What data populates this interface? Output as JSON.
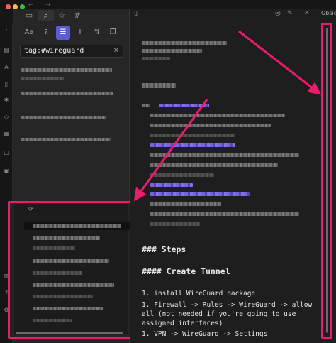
{
  "window": {
    "title": "Obsidian",
    "nav_back": "←",
    "nav_forward": "→"
  },
  "ribbon": {
    "icons": [
      "files-icon",
      "search-icon",
      "graph-icon",
      "calendar-icon",
      "templates-icon",
      "settings-icon"
    ]
  },
  "sidebar": {
    "tabs": [
      {
        "name": "folder-icon",
        "glyph": "▭"
      },
      {
        "name": "search-icon",
        "glyph": "⌕"
      },
      {
        "name": "star-icon",
        "glyph": "☆"
      },
      {
        "name": "hash-icon",
        "glyph": "#"
      }
    ],
    "tools": [
      {
        "name": "text-size-icon",
        "glyph": "Aa"
      },
      {
        "name": "help-icon",
        "glyph": "?"
      },
      {
        "name": "list-icon",
        "glyph": "☰"
      },
      {
        "name": "text-cursor-icon",
        "glyph": "I"
      },
      {
        "name": "sort-icon",
        "glyph": "⇅"
      },
      {
        "name": "copy-icon",
        "glyph": "❐"
      }
    ],
    "search": {
      "value": "tag:#wireguard",
      "clear_glyph": "✕"
    }
  },
  "editor": {
    "title_fragment": "Obsidi",
    "heading_steps": "### Steps",
    "heading_tunnel": "#### Create Tunnel",
    "list_lines": [
      "1. install WireGuard package",
      "1. Firewall -> Rules -> WireGuard -> allow",
      "   all (not needed if you're going to use",
      "   assigned interfaces)",
      "1. VPN -> WireGuard -> Settings"
    ]
  },
  "colors": {
    "accent": "#7f6df2",
    "annotation": "#ee1a6b",
    "background": "#1e1e1e",
    "sidebar": "#262626"
  }
}
